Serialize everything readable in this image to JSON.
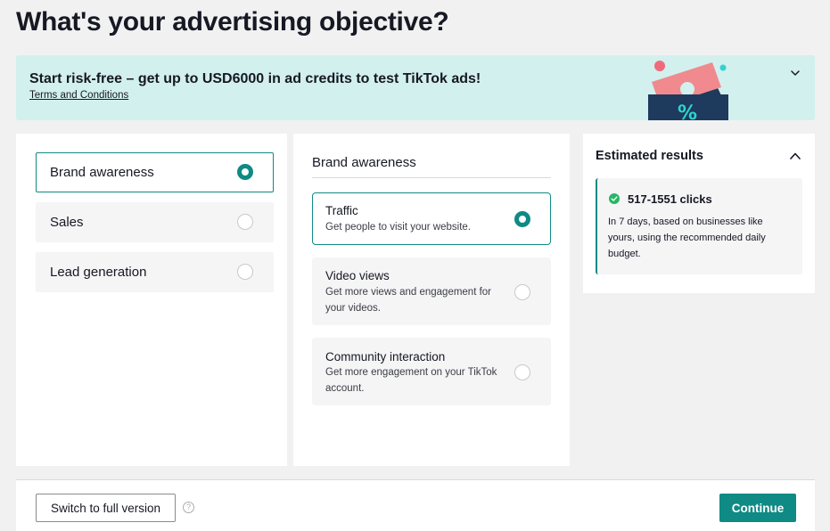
{
  "page": {
    "title": "What's your advertising objective?"
  },
  "banner": {
    "title": "Start risk-free – get up to USD6000 in ad credits to test TikTok ads!",
    "link": "Terms and Conditions",
    "art_symbol": "%",
    "chevron_icon": "chevron-down-icon",
    "colors": {
      "background": "#d2f0ee",
      "ticket": "#f08a8e",
      "envelope": "#1e3a5c",
      "accent": "#2dd4cf"
    }
  },
  "objectives": [
    {
      "label": "Brand awareness",
      "selected": true
    },
    {
      "label": "Sales",
      "selected": false
    },
    {
      "label": "Lead generation",
      "selected": false
    }
  ],
  "suboptions": {
    "heading": "Brand awareness",
    "items": [
      {
        "title": "Traffic",
        "desc": "Get people to visit your website.",
        "selected": true
      },
      {
        "title": "Video views",
        "desc": "Get more views and engagement for your videos.",
        "selected": false
      },
      {
        "title": "Community interaction",
        "desc": "Get more engagement on your TikTok account.",
        "selected": false
      }
    ]
  },
  "estimate": {
    "title": "Estimated results",
    "clicks": "517-1551 clicks",
    "desc": "In 7 days, based on businesses like yours, using the recommended daily budget.",
    "chevron_icon": "chevron-up-icon",
    "check_icon": "check-circle-icon"
  },
  "footer": {
    "switch_label": "Switch to full version",
    "help_symbol": "?",
    "continue_label": "Continue"
  },
  "colors": {
    "accent": "#0f8a84",
    "page_bg": "#f1f1f2",
    "text": "#161823"
  }
}
